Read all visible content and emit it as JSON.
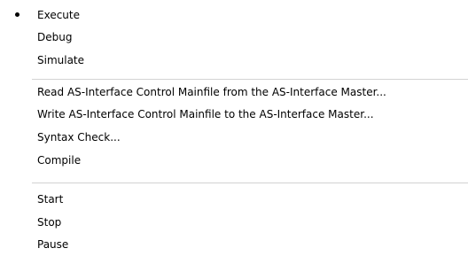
{
  "menu": {
    "groups": [
      {
        "items": [
          {
            "label": "Execute",
            "selected": true
          },
          {
            "label": "Debug",
            "selected": false
          },
          {
            "label": "Simulate",
            "selected": false
          }
        ]
      },
      {
        "items": [
          {
            "label": "Read AS-Interface Control Mainfile from the AS-Interface Master...",
            "selected": false
          },
          {
            "label": "Write AS-Interface Control Mainfile to the AS-Interface Master...",
            "selected": false
          },
          {
            "label": "Syntax Check...",
            "selected": false
          },
          {
            "label": "Compile",
            "selected": false
          }
        ]
      },
      {
        "items": [
          {
            "label": "Start",
            "selected": false
          },
          {
            "label": "Stop",
            "selected": false
          },
          {
            "label": "Pause",
            "selected": false
          }
        ]
      }
    ]
  }
}
